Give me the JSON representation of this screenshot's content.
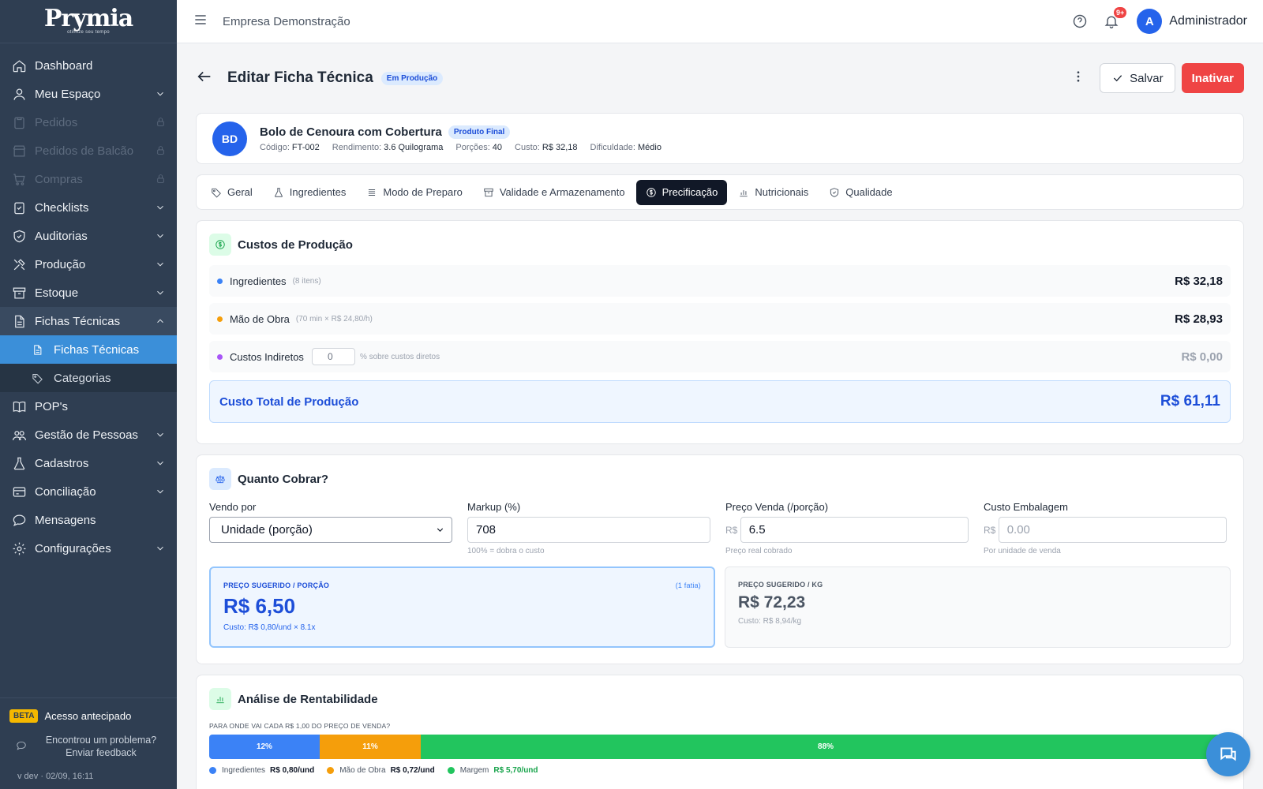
{
  "brand": {
    "name": "Prymia",
    "tagline": "otimize seu tempo"
  },
  "sidebar": {
    "items": [
      {
        "label": "Dashboard",
        "icon": "home-icon"
      },
      {
        "label": "Meu Espaço",
        "icon": "user-icon"
      },
      {
        "label": "Pedidos",
        "icon": "clipboard-icon"
      },
      {
        "label": "Pedidos de Balcão",
        "icon": "store-icon"
      },
      {
        "label": "Compras",
        "icon": "cart-icon"
      },
      {
        "label": "Checklists",
        "icon": "checklist-icon"
      },
      {
        "label": "Auditorias",
        "icon": "shield-icon"
      },
      {
        "label": "Produção",
        "icon": "tools-icon"
      },
      {
        "label": "Estoque",
        "icon": "archive-icon"
      },
      {
        "label": "Fichas Técnicas",
        "icon": "document-icon"
      },
      {
        "label": "POP's",
        "icon": "book-icon"
      },
      {
        "label": "Gestão de Pessoas",
        "icon": "people-icon"
      },
      {
        "label": "Cadastros",
        "icon": "flask-icon"
      },
      {
        "label": "Conciliação",
        "icon": "card-icon"
      },
      {
        "label": "Mensagens",
        "icon": "chat-icon"
      },
      {
        "label": "Configurações",
        "icon": "gear-icon"
      }
    ],
    "sub_items": [
      {
        "label": "Fichas Técnicas",
        "icon": "document-icon"
      },
      {
        "label": "Categorias",
        "icon": "tag-icon"
      }
    ],
    "footer": {
      "beta_badge": "BETA",
      "beta_text": "Acesso antecipado",
      "feedback_line1": "Encontrou um problema?",
      "feedback_line2": "Enviar feedback",
      "version": "v dev · 02/09, 16:11"
    }
  },
  "topbar": {
    "company": "Empresa Demonstração",
    "notif_badge": "9+",
    "avatar_letter": "A",
    "user_name": "Administrador"
  },
  "page": {
    "title": "Editar Ficha Técnica",
    "status": "Em Produção",
    "save_label": "Salvar",
    "inactivate_label": "Inativar"
  },
  "product": {
    "initials": "BD",
    "name": "Bolo de Cenoura com Cobertura",
    "type": "Produto Final",
    "code_label": "Código:",
    "code": "FT-002",
    "yield_label": "Rendimento:",
    "yield": "3.6 Quilograma",
    "portions_label": "Porções:",
    "portions": "40",
    "cost_label": "Custo:",
    "cost": "R$ 32,18",
    "difficulty_label": "Dificuldade:",
    "difficulty": "Médio"
  },
  "tabs": [
    {
      "label": "Geral",
      "icon": "tag-icon"
    },
    {
      "label": "Ingredientes",
      "icon": "flask-icon"
    },
    {
      "label": "Modo de Preparo",
      "icon": "list-icon"
    },
    {
      "label": "Validade e Armazenamento",
      "icon": "archive-icon"
    },
    {
      "label": "Precificação",
      "icon": "dollar-icon",
      "active": true
    },
    {
      "label": "Nutricionais",
      "icon": "bar-chart-icon"
    },
    {
      "label": "Qualidade",
      "icon": "shield-check-icon"
    }
  ],
  "costs": {
    "title": "Custos de Produção",
    "ingredients_label": "Ingredientes",
    "ingredients_note": "(8 itens)",
    "ingredients_value": "R$ 32,18",
    "labor_label": "Mão de Obra",
    "labor_note": "(70 min × R$ 24,80/h)",
    "labor_value": "R$ 28,93",
    "indirect_label": "Custos Indiretos",
    "indirect_input": "0",
    "indirect_note": "% sobre custos diretos",
    "indirect_value": "R$ 0,00",
    "total_label": "Custo Total de Produção",
    "total_value": "R$ 61,11",
    "colors": {
      "ingredients": "#3b82f6",
      "labor": "#f59e0b",
      "indirect": "#a855f7"
    }
  },
  "pricing": {
    "title": "Quanto Cobrar?",
    "sell_by_label": "Vendo por",
    "sell_by_value": "Unidade (porção)",
    "markup_label": "Markup (%)",
    "markup_value": "708",
    "markup_hint": "100% = dobra o custo",
    "price_label": "Preço Venda (/porção)",
    "price_prefix": "R$",
    "price_value": "6.5",
    "price_hint": "Preço real cobrado",
    "packaging_label": "Custo Embalagem",
    "packaging_prefix": "R$",
    "packaging_placeholder": "0.00",
    "packaging_hint": "Por unidade de venda",
    "card1_label": "PREÇO SUGERIDO / PORÇÃO",
    "card1_side": "(1 fatia)",
    "card1_price": "R$ 6,50",
    "card1_sub": "Custo: R$ 0,80/und × 8.1x",
    "card2_label": "PREÇO SUGERIDO / KG",
    "card2_price": "R$ 72,23",
    "card2_sub": "Custo: R$ 8,94/kg"
  },
  "profitability": {
    "title": "Análise de Rentabilidade",
    "question": "PARA ONDE VAI CADA R$ 1,00 DO PREÇO DE VENDA?",
    "segments": [
      {
        "name": "Ingredientes",
        "percent": 12,
        "label": "12%",
        "value": "R$ 0,80/und",
        "color": "#3b82f6"
      },
      {
        "name": "Mão de Obra",
        "percent": 11,
        "label": "11%",
        "value": "R$ 0,72/und",
        "color": "#f59e0b"
      },
      {
        "name": "Margem",
        "percent": 88,
        "label": "88%",
        "value": "R$ 5,70/und",
        "color": "#22c55e"
      }
    ]
  }
}
